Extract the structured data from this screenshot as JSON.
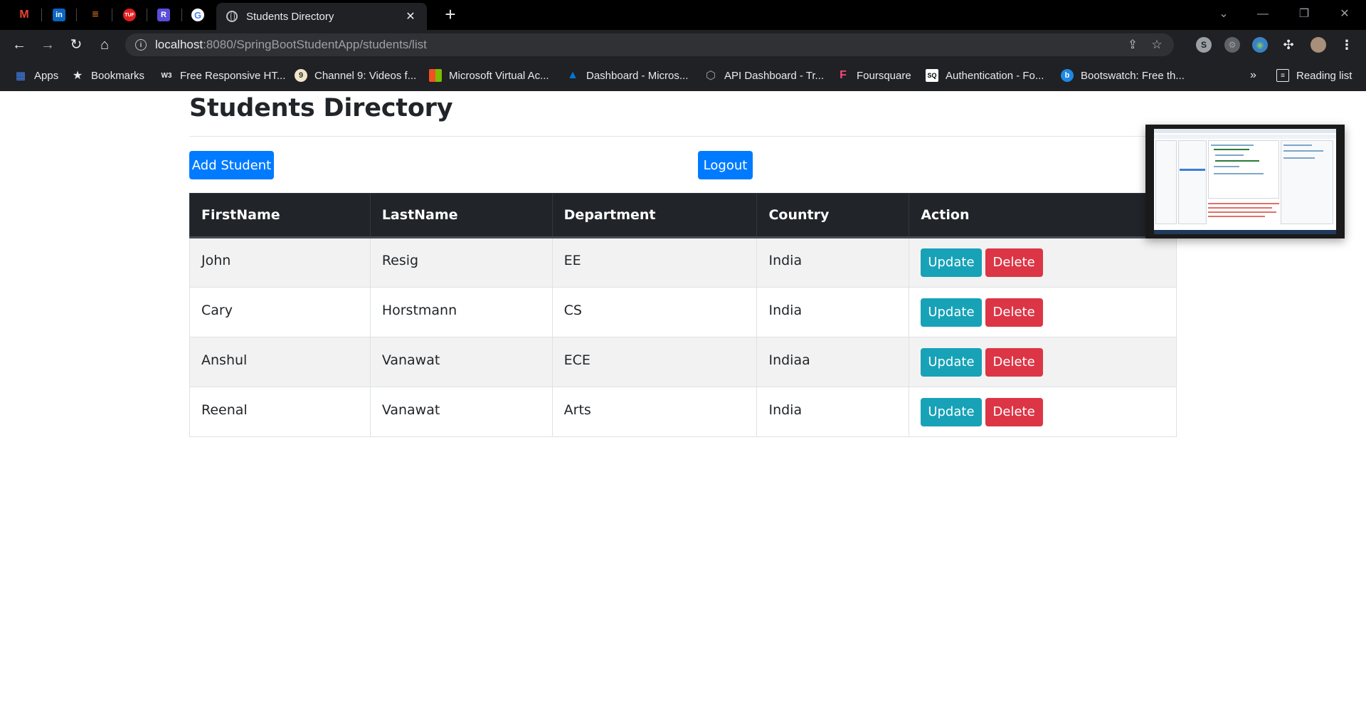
{
  "browser": {
    "active_tab_title": "Students Directory",
    "new_tab_symbol": "+",
    "close_symbol": "✕",
    "url_host": "localhost",
    "url_path": ":8080/SpringBootStudentApp/students/list",
    "pinned_tabs": [
      {
        "name": "gmail-icon",
        "glyph": "M",
        "color": "#ea4335"
      },
      {
        "name": "linkedin-icon",
        "glyph": "in",
        "color": "#0a66c2"
      },
      {
        "name": "stackoverflow-icon",
        "glyph": "≡",
        "color": "#f48024"
      },
      {
        "name": "tuf-icon",
        "glyph": "TUF",
        "color": "#e02020"
      },
      {
        "name": "r-icon",
        "glyph": "R",
        "color": "#5b4ddb"
      },
      {
        "name": "google-icon",
        "glyph": "G",
        "color": "#ffffff"
      }
    ],
    "bookmarks": [
      {
        "label": "Apps",
        "icon": "apps-grid-icon"
      },
      {
        "label": "Bookmarks",
        "icon": "star-icon"
      },
      {
        "label": "Free Responsive HT...",
        "icon": "w3-icon"
      },
      {
        "label": "Channel 9: Videos f...",
        "icon": "channel9-icon"
      },
      {
        "label": "Microsoft Virtual Ac...",
        "icon": "microsoft-icon"
      },
      {
        "label": "Dashboard - Micros...",
        "icon": "azure-icon"
      },
      {
        "label": "API Dashboard - Tr...",
        "icon": "api-icon"
      },
      {
        "label": "Foursquare",
        "icon": "foursquare-icon"
      },
      {
        "label": "Authentication - Fo...",
        "icon": "sq-icon"
      },
      {
        "label": "Bootswatch: Free th...",
        "icon": "bootswatch-icon"
      }
    ],
    "bookmarks_overflow": "»",
    "reading_list": "Reading list"
  },
  "page": {
    "title": "Students Directory",
    "add_button": "Add Student",
    "logout_button": "Logout",
    "table": {
      "headers": [
        "FirstName",
        "LastName",
        "Department",
        "Country",
        "Action"
      ],
      "rows": [
        {
          "first": "John",
          "last": "Resig",
          "dept": "EE",
          "country": "India"
        },
        {
          "first": "Cary",
          "last": "Horstmann",
          "dept": "CS",
          "country": "India"
        },
        {
          "first": "Anshul",
          "last": "Vanawat",
          "dept": "ECE",
          "country": "Indiaa"
        },
        {
          "first": "Reenal",
          "last": "Vanawat",
          "dept": "Arts",
          "country": "India"
        }
      ],
      "update_label": "Update",
      "delete_label": "Delete"
    }
  },
  "colors": {
    "primary": "#007bff",
    "info": "#17a2b8",
    "danger": "#dc3545",
    "table_header": "#212529"
  }
}
